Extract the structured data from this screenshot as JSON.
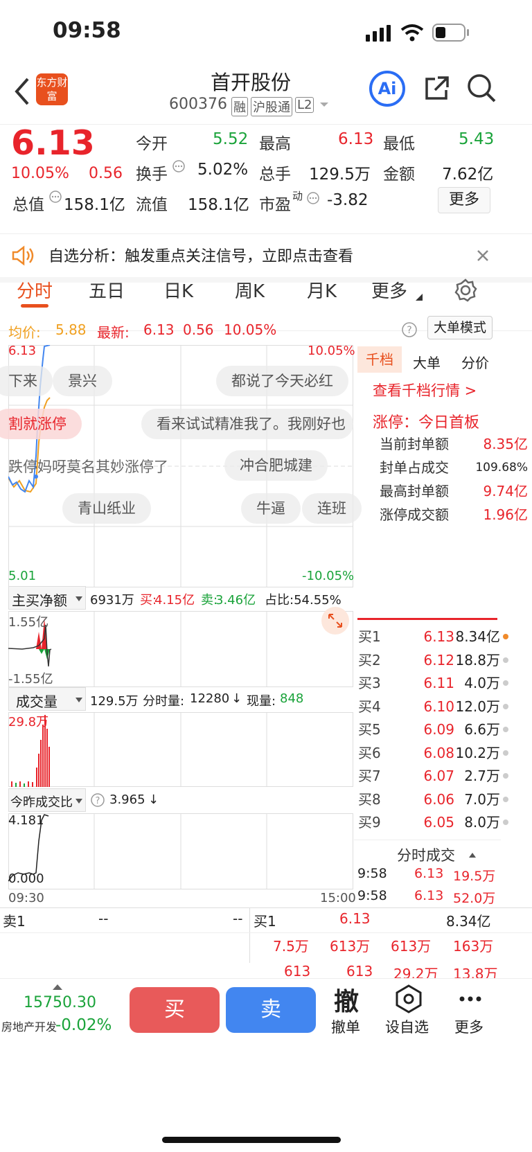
{
  "status_bar": {
    "time": "09:58"
  },
  "header": {
    "back_icon": "chevron-left-icon",
    "logo_text": "东方财富",
    "title": "首开股份",
    "code": "600376",
    "tags": [
      "融",
      "沪股通",
      "L2"
    ],
    "ai_label": "Ai",
    "share_icon": "share-icon",
    "search_icon": "search-icon"
  },
  "quote": {
    "price": "6.13",
    "pct": "10.05%",
    "chg": "0.56",
    "open_label": "今开",
    "open": "5.52",
    "high_label": "最高",
    "high": "6.13",
    "low_label": "最低",
    "low": "5.43",
    "turnover_label": "换手",
    "turnover": "5.02%",
    "volume_label": "总手",
    "volume": "129.5万",
    "amount_label": "金额",
    "amount": "7.62亿",
    "mktcap_label": "总值",
    "mktcap": "158.1亿",
    "float_label": "流值",
    "float": "158.1亿",
    "pe_label": "市盈",
    "pe_sup": "动",
    "pe": "-3.82",
    "more": "更多"
  },
  "banner": {
    "text": "自选分析：触发重点关注信号，立即点击查看"
  },
  "tabs": {
    "items": [
      "分时",
      "五日",
      "日K",
      "周K",
      "月K",
      "更多"
    ],
    "active": 0
  },
  "info_line": {
    "avg_label": "均价:",
    "avg": "5.88",
    "latest_label": "最新:",
    "latest": "6.13",
    "chg": "0.56",
    "pct": "10.05%",
    "mode_button": "大单模式"
  },
  "main_chart": {
    "y_top": "6.13",
    "y_bottom": "5.01",
    "pct_top": "10.05%",
    "pct_bottom": "-10.05%",
    "x_start": "09:30",
    "x_end": "15:00"
  },
  "bubbles": [
    "下来",
    "景兴",
    "都说了今天必红",
    "割就涨停",
    "看来试试精准我了。我刚好也",
    "跌停妈呀莫名其妙涨停了",
    "冲合肥城建",
    "青山纸业",
    "牛逼",
    "连班"
  ],
  "flow": {
    "selector": "主买净额",
    "value": "6931万",
    "buy_label": "买:",
    "buy": "4.15亿",
    "sell_label": "卖:",
    "sell": "3.46亿",
    "ratio": "占比:54.55%",
    "y_top": "1.55亿",
    "y_bottom": "-1.55亿"
  },
  "volume": {
    "selector": "成交量",
    "total": "129.5万",
    "tick_label": "分时量:",
    "tick": "12280",
    "cur_label": "现量:",
    "cur": "848",
    "y_top": "29.8万"
  },
  "ratio_panel": {
    "selector": "今昨成交比",
    "value": "3.965",
    "y_top": "4.181",
    "y_bottom": "0.000"
  },
  "right_tabs": {
    "items": [
      "千档",
      "大单",
      "分价"
    ],
    "active": 0,
    "link": "查看千档行情 >"
  },
  "limit_up": {
    "title": "涨停：今日首板",
    "rows": [
      {
        "label": "当前封单额",
        "value": "8.35亿"
      },
      {
        "label": "封单占成交",
        "value": "109.68%"
      },
      {
        "label": "最高封单额",
        "value": "9.74亿"
      },
      {
        "label": "涨停成交额",
        "value": "1.96亿"
      }
    ]
  },
  "orderbook": [
    {
      "label": "买1",
      "price": "6.13",
      "vol": "8.34亿"
    },
    {
      "label": "买2",
      "price": "6.12",
      "vol": "18.8万"
    },
    {
      "label": "买3",
      "price": "6.11",
      "vol": "4.0万"
    },
    {
      "label": "买4",
      "price": "6.10",
      "vol": "12.0万"
    },
    {
      "label": "买5",
      "price": "6.09",
      "vol": "6.6万"
    },
    {
      "label": "买6",
      "price": "6.08",
      "vol": "10.2万"
    },
    {
      "label": "买7",
      "price": "6.07",
      "vol": "2.7万"
    },
    {
      "label": "买8",
      "price": "6.06",
      "vol": "7.0万"
    },
    {
      "label": "买9",
      "price": "6.05",
      "vol": "8.0万"
    }
  ],
  "trades": {
    "title": "分时成交",
    "rows": [
      {
        "time": "9:58",
        "price": "6.13",
        "vol": "19.5万"
      },
      {
        "time": "9:58",
        "price": "6.13",
        "vol": "52.0万"
      }
    ]
  },
  "bottom_book": {
    "sell_label": "卖1",
    "sell_price": "--",
    "sell_vol": "--",
    "buy_label": "买1",
    "buy_price": "6.13",
    "buy_vol": "8.34亿",
    "row2": [
      "7.5万",
      "613万",
      "613万",
      "163万"
    ],
    "row3": [
      "613",
      "613",
      "29.2万",
      "13.8万"
    ]
  },
  "footer": {
    "index_value": "15750.30",
    "index_name": "房地产开发",
    "index_pct": "-0.02%",
    "buy": "买",
    "sell": "卖",
    "cancel_icon_text": "撤",
    "cancel": "撤单",
    "watch": "设自选",
    "more": "更多"
  },
  "colors": {
    "up": "#e8242b",
    "down": "#1aa33a",
    "avg": "#f0a020",
    "buy_button": "#e85a5a",
    "sell_button": "#4286f0",
    "ai": "#2a6df4"
  }
}
